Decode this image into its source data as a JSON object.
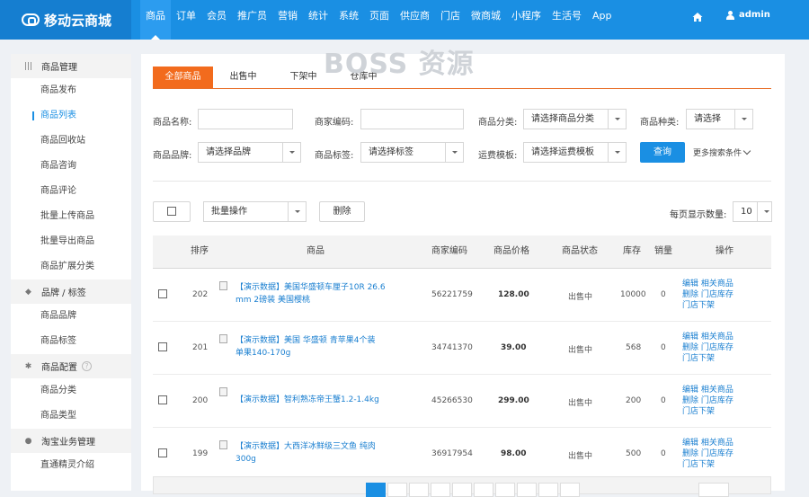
{
  "brand": {
    "name": "移动云商城"
  },
  "nav": {
    "items": [
      "商品",
      "订单",
      "会员",
      "推广员",
      "营销",
      "统计",
      "系统",
      "页面",
      "供应商",
      "门店",
      "微商城",
      "小程序",
      "生活号",
      "App"
    ],
    "active": 0
  },
  "user": {
    "name": "admin"
  },
  "watermark": "BOSS 资源",
  "sidebar": {
    "groups": [
      {
        "title": "商品管理",
        "icon": "barcode-icon",
        "items": [
          "商品发布",
          "商品列表",
          "商品回收站",
          "商品咨询",
          "商品评论",
          "批量上传商品",
          "批量导出商品",
          "商品扩展分类"
        ]
      },
      {
        "title": "品牌 / 标签",
        "icon": "tag-icon",
        "items": [
          "商品品牌",
          "商品标签"
        ]
      },
      {
        "title": "商品配置",
        "icon": "gear-icon",
        "items": [
          "商品分类",
          "商品类型"
        ]
      },
      {
        "title": "淘宝业务管理",
        "icon": "taobao-icon",
        "items": [
          "直通精灵介绍"
        ]
      }
    ],
    "active_item": "商品列表"
  },
  "tabs": [
    "全部商品",
    "出售中",
    "下架中",
    "仓库中"
  ],
  "filters": {
    "name_label": "商品名称:",
    "code_label": "商家编码:",
    "category_label": "商品分类:",
    "category_value": "请选择商品分类",
    "kind_label": "商品种类:",
    "kind_value": "请选择",
    "brand_label": "商品品牌:",
    "brand_value": "请选择品牌",
    "tag_label": "商品标签:",
    "tag_value": "请选择标签",
    "shipping_label": "运费模板:",
    "shipping_value": "请选择运费模板",
    "query_button": "查询",
    "more_label": "更多搜索条件"
  },
  "toolbar": {
    "batch_label": "批量操作",
    "delete_label": "删除",
    "perpage_label": "每页显示数量:",
    "perpage_value": "10"
  },
  "table": {
    "headers": [
      "排序",
      "商品",
      "商家编码",
      "商品价格",
      "商品状态",
      "库存",
      "销量",
      "操作"
    ],
    "rows": [
      {
        "sort": "202",
        "name_line1": "【演示数据】美国华盛顿车厘子10R 26.6",
        "name_line2": "mm 2磅装 美国樱桃",
        "code": "56221759",
        "price": "128.00",
        "status": "出售中",
        "stock": "10000",
        "sales": "0"
      },
      {
        "sort": "201",
        "name_line1": "【演示数据】美国 华盛顿 青苹果4个装",
        "name_line2": "单果140-170g",
        "code": "34741370",
        "price": "39.00",
        "status": "出售中",
        "stock": "568",
        "sales": "0"
      },
      {
        "sort": "200",
        "name_line1": "【演示数据】智利熟冻帝王蟹1.2-1.4kg",
        "name_line2": "",
        "code": "45266530",
        "price": "299.00",
        "status": "出售中",
        "stock": "200",
        "sales": "0"
      },
      {
        "sort": "199",
        "name_line1": "【演示数据】大西洋冰鲜级三文鱼 纯肉",
        "name_line2": "300g",
        "code": "36917954",
        "price": "98.00",
        "status": "出售中",
        "stock": "500",
        "sales": "0"
      }
    ],
    "ops": {
      "line1": "编辑  相关商品",
      "line2": "删除  门店库存",
      "line3": "门店下架"
    }
  }
}
